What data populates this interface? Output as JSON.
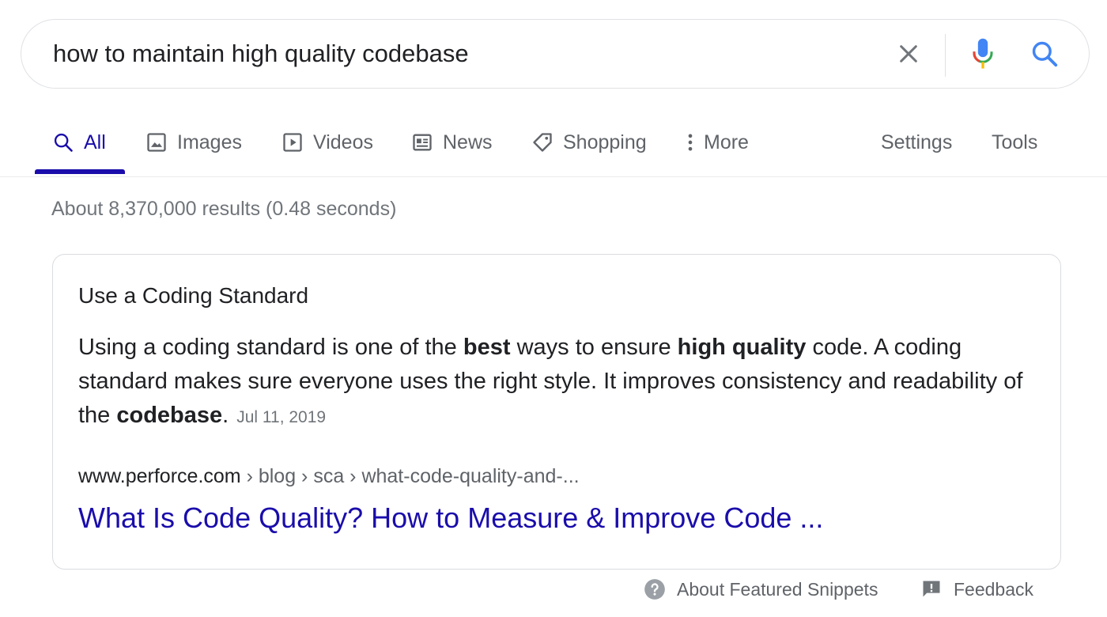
{
  "search": {
    "query": "how to maintain high quality codebase"
  },
  "tabs": [
    {
      "label": "All",
      "icon": "search-icon",
      "active": true
    },
    {
      "label": "Images",
      "icon": "image-icon"
    },
    {
      "label": "Videos",
      "icon": "play-icon"
    },
    {
      "label": "News",
      "icon": "news-icon"
    },
    {
      "label": "Shopping",
      "icon": "tag-icon"
    },
    {
      "label": "More",
      "icon": "more-vert-icon"
    }
  ],
  "tools": {
    "settings_label": "Settings",
    "tools_label": "Tools"
  },
  "result_stats": "About 8,370,000 results (0.48 seconds)",
  "snippet": {
    "heading": "Use a Coding Standard",
    "body_parts": [
      {
        "text": "Using a coding standard is one of the ",
        "bold": false
      },
      {
        "text": "best",
        "bold": true
      },
      {
        "text": " ways to ensure ",
        "bold": false
      },
      {
        "text": "high quality",
        "bold": true
      },
      {
        "text": " code. A coding standard makes sure everyone uses the right style. It improves consistency and readability of the ",
        "bold": false
      },
      {
        "text": "codebase",
        "bold": true
      },
      {
        "text": ".",
        "bold": false
      }
    ],
    "date": "Jul 11, 2019",
    "url_domain": "www.perforce.com",
    "url_crumbs": " › blog › sca › what-code-quality-and-...",
    "title": "What Is Code Quality? How to Measure & Improve Code ..."
  },
  "footer": {
    "about_label": "About Featured Snippets",
    "feedback_label": "Feedback"
  },
  "colors": {
    "link": "#1a0dab",
    "mic": "#4285f4",
    "muted": "#70757a"
  }
}
